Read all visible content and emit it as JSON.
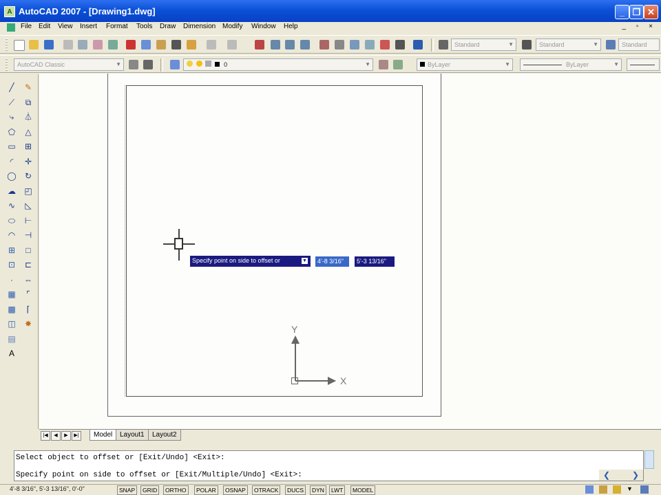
{
  "window": {
    "title": "AutoCAD 2007 - [Drawing1.dwg]",
    "minimize": "_",
    "restore": "❐",
    "close": "✕",
    "doc_controls": "_ ▫ ×"
  },
  "menu": [
    "File",
    "Edit",
    "View",
    "Insert",
    "Format",
    "Tools",
    "Draw",
    "Dimension",
    "Modify",
    "Window",
    "Help"
  ],
  "toolbars": {
    "text_style": "Standard",
    "dim_style": "Standard",
    "table_style": "Standard",
    "workspace": "AutoCAD Classic",
    "layer_value": "0",
    "color": "ByLayer",
    "linetype": "ByLayer"
  },
  "draw_tools": [
    "line-icon",
    "construction-line-icon",
    "polyline-icon",
    "polygon-icon",
    "rectangle-icon",
    "arc-icon",
    "circle-icon",
    "revision-cloud-icon",
    "spline-icon",
    "ellipse-icon",
    "ellipse-arc-icon",
    "insert-block-icon",
    "make-block-icon",
    "point-icon",
    "hatch-icon",
    "gradient-icon",
    "region-icon",
    "table-icon",
    "multiline-text-icon"
  ],
  "modify_tools": [
    "erase-icon",
    "copy-icon",
    "mirror-icon",
    "offset-icon",
    "array-icon",
    "move-icon",
    "rotate-icon",
    "scale-icon",
    "stretch-icon",
    "trim-icon",
    "extend-icon",
    "break-at-point-icon",
    "break-icon",
    "join-icon",
    "chamfer-icon",
    "fillet-icon",
    "explode-icon"
  ],
  "dynamic_input": {
    "prompt": "Specify point on side to offset or",
    "x_value": "4'-8 3/16\"",
    "y_value": "5'-3 13/16\""
  },
  "ucs": {
    "x_label": "X",
    "y_label": "Y"
  },
  "layout_tabs": [
    "Model",
    "Layout1",
    "Layout2"
  ],
  "tab_nav": [
    "|◀",
    "◀",
    "▶",
    "▶|"
  ],
  "command_history": [
    "Select object to offset or [Exit/Undo] <Exit>:",
    "Specify point on side to offset or [Exit/Multiple/Undo] <Exit>:"
  ],
  "status": {
    "coordinates": "4'-8 3/16\", 5'-3 13/16\", 0'-0\"",
    "buttons": [
      "SNAP",
      "GRID",
      "ORTHO",
      "POLAR",
      "OSNAP",
      "OTRACK",
      "DUCS",
      "DYN",
      "LWT",
      "MODEL"
    ]
  }
}
